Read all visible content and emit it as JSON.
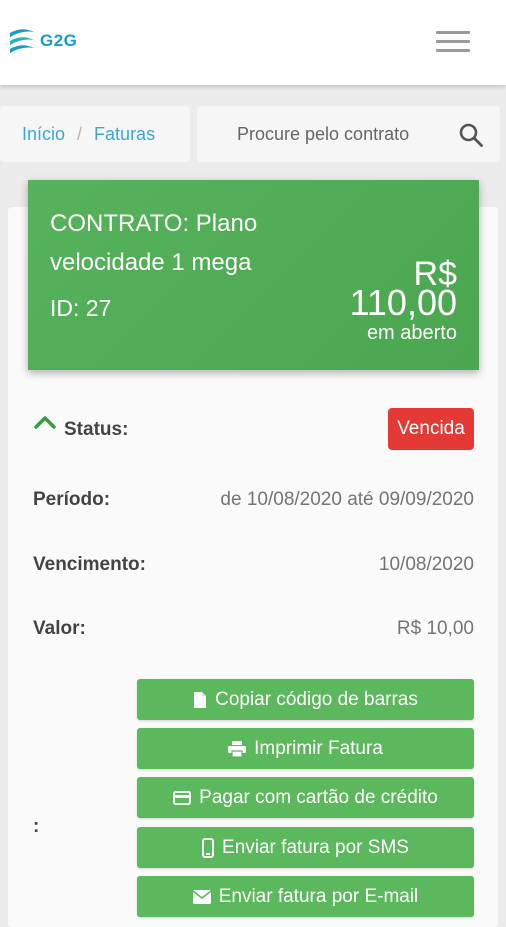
{
  "app": {
    "logo_text": "G2G"
  },
  "breadcrumb": {
    "home": "Início",
    "separator": "/",
    "current": "Faturas"
  },
  "search": {
    "placeholder": "Procure pelo contrato",
    "value": ""
  },
  "contract": {
    "title": "CONTRATO: Plano velocidade 1 mega",
    "id_label": "ID: 27",
    "currency": "R$",
    "amount": "110,00",
    "amount_status": "em aberto"
  },
  "invoice": {
    "status_label": "Status:",
    "status_value": "Vencida",
    "period_label": "Período:",
    "period_value": "de 10/08/2020 até 09/09/2020",
    "due_label": "Vencimento:",
    "due_value": "10/08/2020",
    "value_label": "Valor:",
    "value_value": "R$ 10,00",
    "actions_label": ":"
  },
  "actions": [
    {
      "label": "Copiar código de barras",
      "icon": "file-icon"
    },
    {
      "label": "Imprimir Fatura",
      "icon": "print-icon"
    },
    {
      "label": "Pagar com cartão de crédito",
      "icon": "credit-card-icon"
    },
    {
      "label": "Enviar fatura por SMS",
      "icon": "mobile-icon"
    },
    {
      "label": "Enviar fatura por E-mail",
      "icon": "envelope-icon"
    }
  ],
  "colors": {
    "brand": "#1a9bc7",
    "banner_green": "#4caf50",
    "button_green": "#5cb85c",
    "status_red": "#e53935",
    "link_blue": "#3aa7d8"
  }
}
